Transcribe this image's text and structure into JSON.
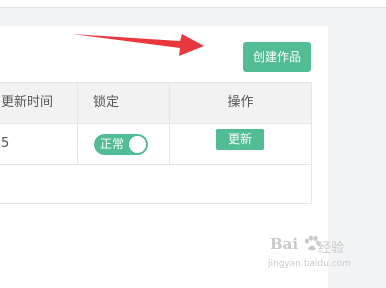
{
  "toolbar": {
    "create_label": "创建作品"
  },
  "table": {
    "headers": [
      "更新时间",
      "锁定",
      "操作"
    ],
    "rows": [
      {
        "update_time": "5",
        "lock_status": "正常",
        "action_label": "更新"
      }
    ]
  },
  "watermark": {
    "logo": "Bai",
    "logo_cn": "经验",
    "url": "jingyan.baidu.com"
  },
  "colors": {
    "accent": "#52bd94",
    "arrow": "#e8383d",
    "header_bg": "#f2f2f2"
  },
  "icons": {
    "arrow": "red-arrow-annotation",
    "paw": "baidu-paw-icon"
  }
}
